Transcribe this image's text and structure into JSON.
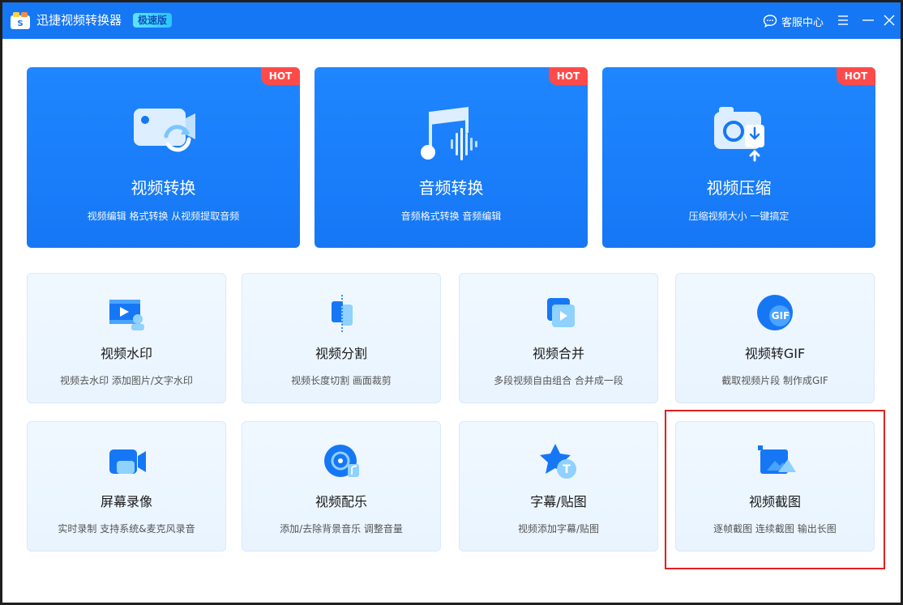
{
  "app": {
    "title": "迅捷视频转换器",
    "edition": "极速版",
    "support_label": "客服中心"
  },
  "colors": {
    "brand_blue": "#1677f5",
    "hot_red": "#ff4a4a",
    "card_bg": "#eef7ff",
    "highlight_red": "#e02020"
  },
  "featured": [
    {
      "title": "视频转换",
      "desc": "视频编辑 格式转换 从视频提取音频",
      "badge": "HOT",
      "icon": "video-convert-icon"
    },
    {
      "title": "音频转换",
      "desc": "音频格式转换 音频编辑",
      "badge": "HOT",
      "icon": "audio-convert-icon"
    },
    {
      "title": "视频压缩",
      "desc": "压缩视频大小 一键搞定",
      "badge": "HOT",
      "icon": "video-compress-icon"
    }
  ],
  "tools": [
    {
      "title": "视频水印",
      "desc": "视频去水印 添加图片/文字水印",
      "icon": "watermark-icon"
    },
    {
      "title": "视频分割",
      "desc": "视频长度切割 画面裁剪",
      "icon": "split-icon"
    },
    {
      "title": "视频合并",
      "desc": "多段视频自由组合 合并成一段",
      "icon": "merge-icon"
    },
    {
      "title": "视频转GIF",
      "desc": "截取视频片段 制作成GIF",
      "icon": "gif-icon",
      "icon_text": "GIF"
    },
    {
      "title": "屏幕录像",
      "desc": "实时录制 支持系统&麦克风录音",
      "icon": "screen-record-icon"
    },
    {
      "title": "视频配乐",
      "desc": "添加/去除背景音乐 调整音量",
      "icon": "music-icon"
    },
    {
      "title": "字幕/贴图",
      "desc": "视频添加字幕/贴图",
      "icon": "subtitle-icon",
      "icon_text": "T"
    },
    {
      "title": "视频截图",
      "desc": "逐帧截图 连续截图 输出长图",
      "icon": "screenshot-icon"
    }
  ]
}
